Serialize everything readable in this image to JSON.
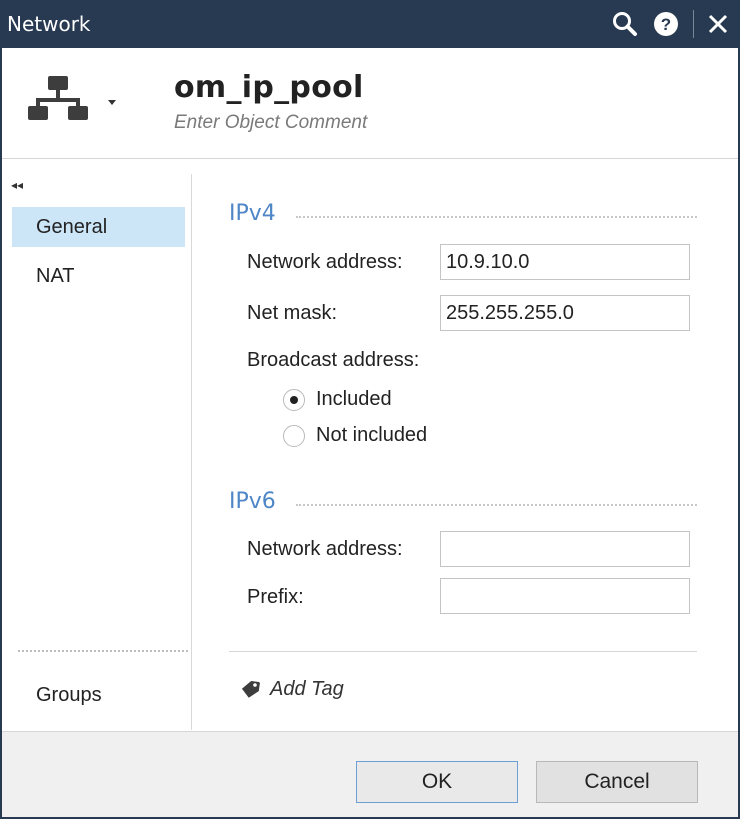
{
  "window": {
    "title": "Network"
  },
  "header": {
    "object_name": "om_ip_pool",
    "comment_placeholder": "Enter Object Comment"
  },
  "sidebar": {
    "collapse_glyph": "◂◂",
    "items": [
      {
        "label": "General",
        "active": true
      },
      {
        "label": "NAT",
        "active": false
      }
    ],
    "groups_label": "Groups"
  },
  "ipv4": {
    "title": "IPv4",
    "network_address_label": "Network address:",
    "network_address_value": "10.9.10.0",
    "net_mask_label": "Net mask:",
    "net_mask_value": "255.255.255.0",
    "broadcast_label": "Broadcast address:",
    "broadcast_options": [
      {
        "label": "Included",
        "checked": true
      },
      {
        "label": "Not included",
        "checked": false
      }
    ]
  },
  "ipv6": {
    "title": "IPv6",
    "network_address_label": "Network address:",
    "network_address_value": "",
    "prefix_label": "Prefix:",
    "prefix_value": ""
  },
  "tags": {
    "add_tag_label": "Add Tag"
  },
  "footer": {
    "ok_label": "OK",
    "cancel_label": "Cancel"
  },
  "colors": {
    "titlebar": "#283a52",
    "accent": "#4f86c6",
    "selected_item": "#cce5f7"
  }
}
